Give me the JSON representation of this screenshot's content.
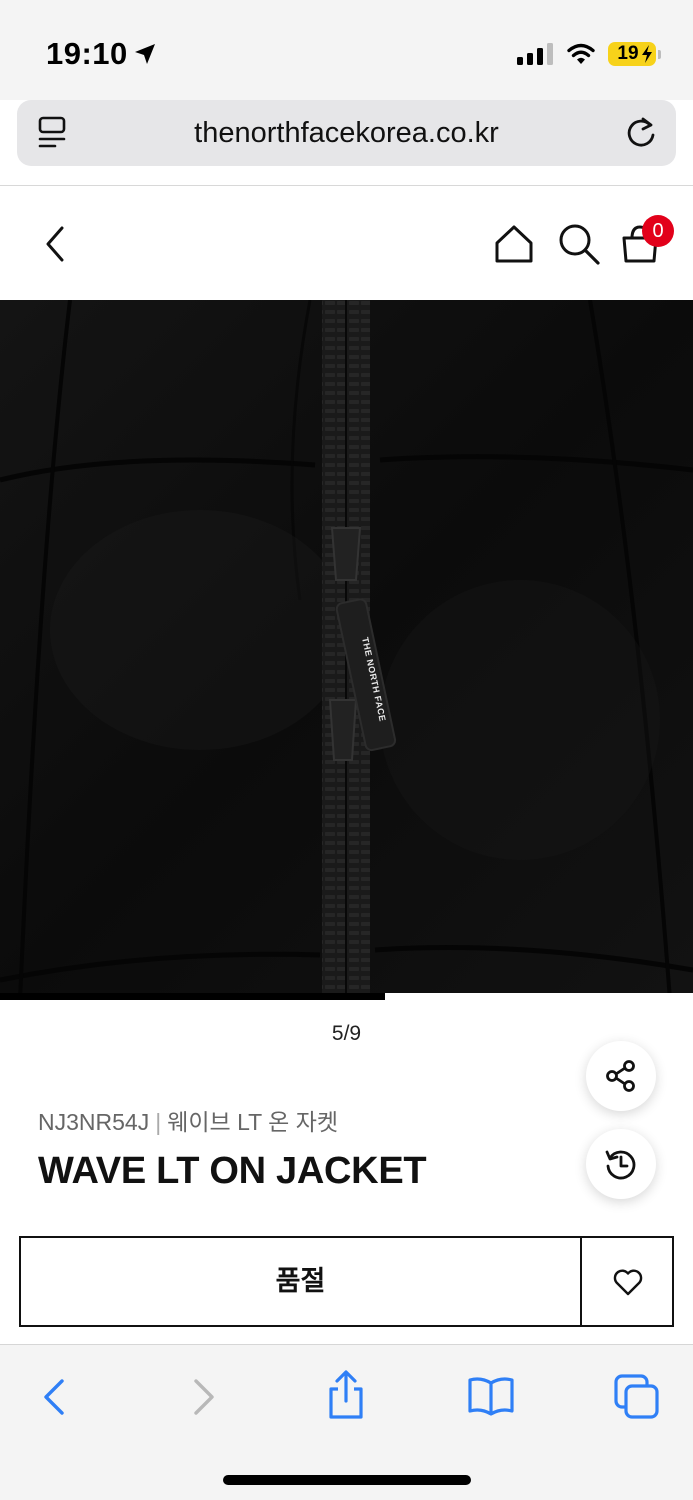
{
  "status_bar": {
    "time": "19:10",
    "battery": "19",
    "icons": [
      "location-arrow-icon",
      "cellular-signal-icon",
      "wifi-icon",
      "battery-charging-icon"
    ]
  },
  "browser": {
    "url": "thenorthfacekorea.co.kr",
    "icons": [
      "reader-icon",
      "reload-icon"
    ]
  },
  "header": {
    "cart_count": "0",
    "icons": [
      "back-chevron-icon",
      "home-icon",
      "search-icon",
      "cart-bag-icon"
    ]
  },
  "gallery": {
    "current": "5",
    "total": "9",
    "progress": 0.5556,
    "counter_text": "5/9",
    "zipper_tag": "THE NORTH FACE"
  },
  "product": {
    "code": "NJ3NR54J",
    "separator": "|",
    "name_ko": "웨이브 LT 온 자켓",
    "name_en": "WAVE LT ON JACKET"
  },
  "actions": {
    "soldout_label": "품절",
    "icons": [
      "share-icon",
      "recently-viewed-icon",
      "heart-icon"
    ]
  },
  "toolbar": {
    "icons": [
      "back-icon",
      "forward-icon",
      "share-icon",
      "bookmarks-icon",
      "tabs-icon"
    ]
  },
  "colors": {
    "accent_red": "#e2001a",
    "safari_blue": "#2f7ff6",
    "battery_yellow": "#f7d21a"
  }
}
